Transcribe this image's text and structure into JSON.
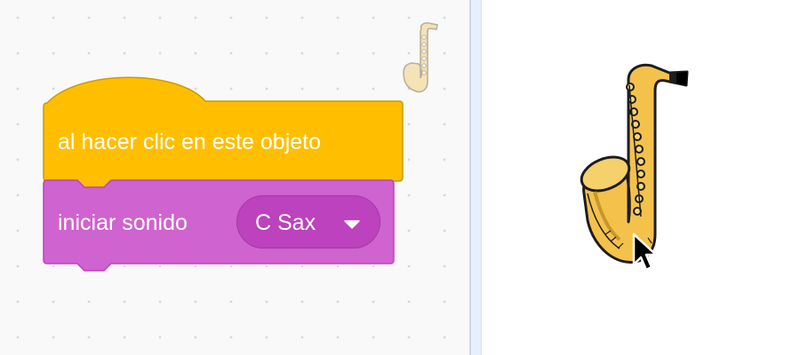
{
  "workspace": {
    "sprite_thumbnail_icon": "saxophone-icon",
    "hat_block": {
      "label": "al hacer clic en este objeto",
      "color": "#ffbf00",
      "border_color": "#cc9900"
    },
    "stack_block": {
      "label": "iniciar sonido",
      "color": "#cf63cf",
      "border_color": "#bd42bd",
      "sound_dropdown": {
        "selected": "C Sax",
        "arrow_icon": "triangle-down-icon",
        "color": "#bd42bd"
      }
    }
  },
  "stage": {
    "sprite_icon": "saxophone-icon",
    "cursor_icon": "mouse-pointer-icon",
    "background": "#ffffff"
  }
}
